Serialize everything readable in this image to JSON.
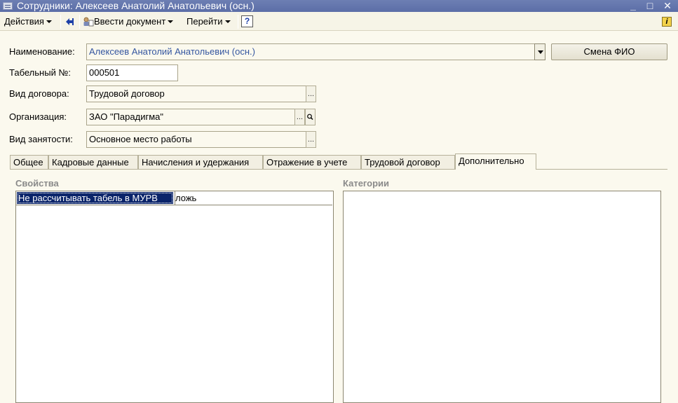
{
  "window": {
    "title": "Сотрудники: Алексеев Анатолий Анатольевич (осн.)",
    "minimize": "_",
    "maximize": "□",
    "close": "✕"
  },
  "toolbar": {
    "actions": "Действия",
    "enter_document": "Ввести документ",
    "goto": "Перейти",
    "help": "?",
    "info": "i"
  },
  "form": {
    "name_label": "Наименование:",
    "name_value": "Алексеев Анатолий Анатольевич (осн.)",
    "change_fio": "Смена ФИО",
    "tab_no_label": "Табельный №:",
    "tab_no_value": "000501",
    "contract_type_label": "Вид договора:",
    "contract_type_value": "Трудовой договор",
    "organization_label": "Организация:",
    "organization_value": "ЗАО \"Парадигма\"",
    "employment_type_label": "Вид занятости:",
    "employment_type_value": "Основное место работы",
    "ellipsis": "..."
  },
  "tabs": [
    {
      "label": "Общее"
    },
    {
      "label": "Кадровые данные"
    },
    {
      "label": "Начисления и удержания"
    },
    {
      "label": "Отражение в учете"
    },
    {
      "label": "Трудовой договор"
    },
    {
      "label": "Дополнительно"
    }
  ],
  "active_tab": "Дополнительно",
  "properties": {
    "title": "Свойства",
    "rows": [
      {
        "name": "Не рассчитывать табель в МУРВ",
        "value": "ложь"
      }
    ]
  },
  "categories": {
    "title": "Категории"
  },
  "colors": {
    "titlebar": "#6d7fb3",
    "background": "#fbf9ee",
    "selection": "#0a246a"
  }
}
